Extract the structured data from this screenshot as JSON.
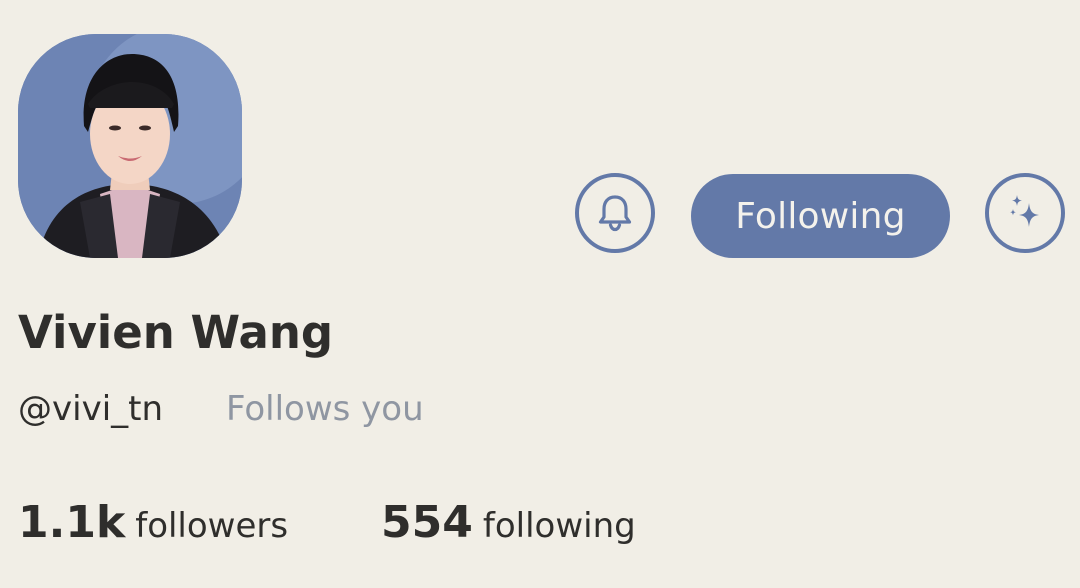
{
  "profile": {
    "name": "Vivien Wang",
    "handle": "@vivi_tn",
    "follows_you": "Follows you",
    "avatar_alt": "profile photo"
  },
  "actions": {
    "notify_icon": "bell-icon",
    "following_label": "Following",
    "sparkle_icon": "sparkle-icon"
  },
  "stats": {
    "followers_count": "1.1k",
    "followers_label": "followers",
    "following_count": "554",
    "following_label": "following"
  },
  "colors": {
    "background": "#f1eee6",
    "accent": "#6379a8",
    "text": "#2f2e2c",
    "muted": "#8f96a2"
  }
}
